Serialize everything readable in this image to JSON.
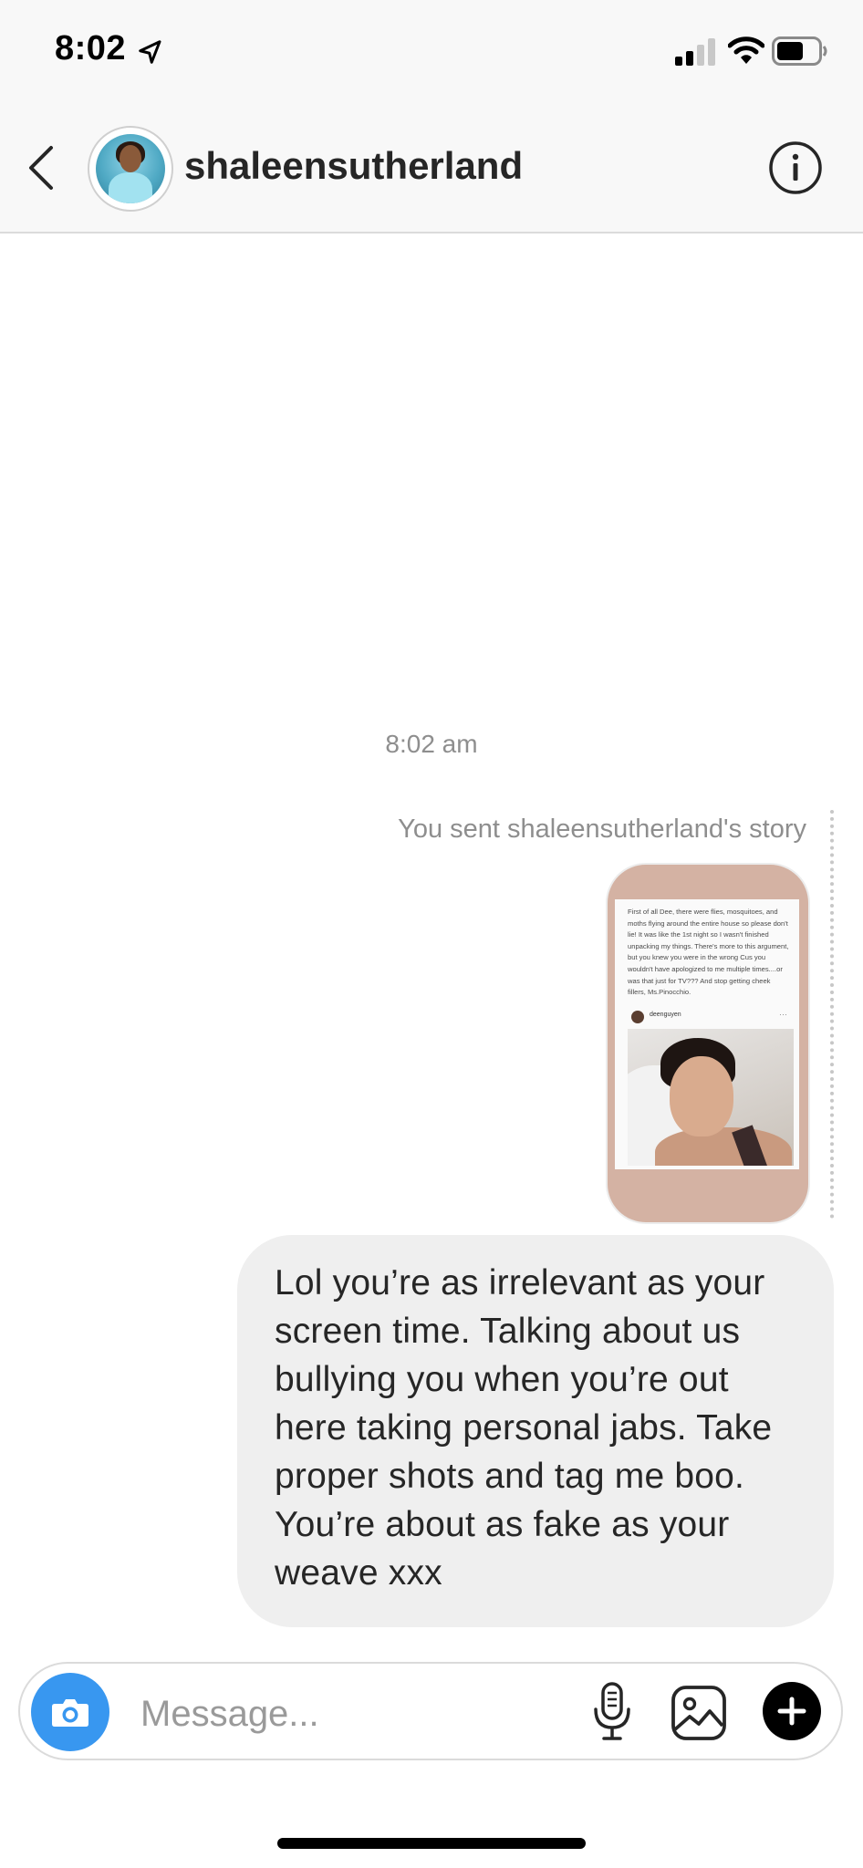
{
  "status_bar": {
    "time": "8:02"
  },
  "header": {
    "username": "shaleensutherland"
  },
  "conversation": {
    "timestamp": "8:02 am",
    "story_caption": "You sent shaleensutherland's story",
    "story_preview": {
      "text": "First of all Dee, there were flies, mosquitoes, and moths flying around the entire house so please don't lie! It was like the 1st night so I wasn't finished unpacking my things. There's more to this argument, but you knew you were in the wrong Cus you wouldn't have apologized to me multiple times....or was that just for TV??? And stop getting cheek fillers, Ms.Pinocchio.",
      "post_username": "deenguyen",
      "post_menu": "···"
    },
    "sent_message": "Lol you’re as irrelevant as your screen time. Talking about us bullying you when you’re out here taking personal jabs. Take proper shots and tag me boo. You’re about as fake as your weave xxx"
  },
  "composer": {
    "placeholder": "Message..."
  },
  "colors": {
    "accent": "#3897f0",
    "bubble": "#efefef",
    "muted_text": "#8e8e8e"
  },
  "icons": [
    "location-arrow-icon",
    "signal-icon",
    "wifi-icon",
    "battery-icon",
    "back-chevron-icon",
    "info-icon",
    "camera-icon",
    "microphone-icon",
    "gallery-icon",
    "plus-icon"
  ]
}
